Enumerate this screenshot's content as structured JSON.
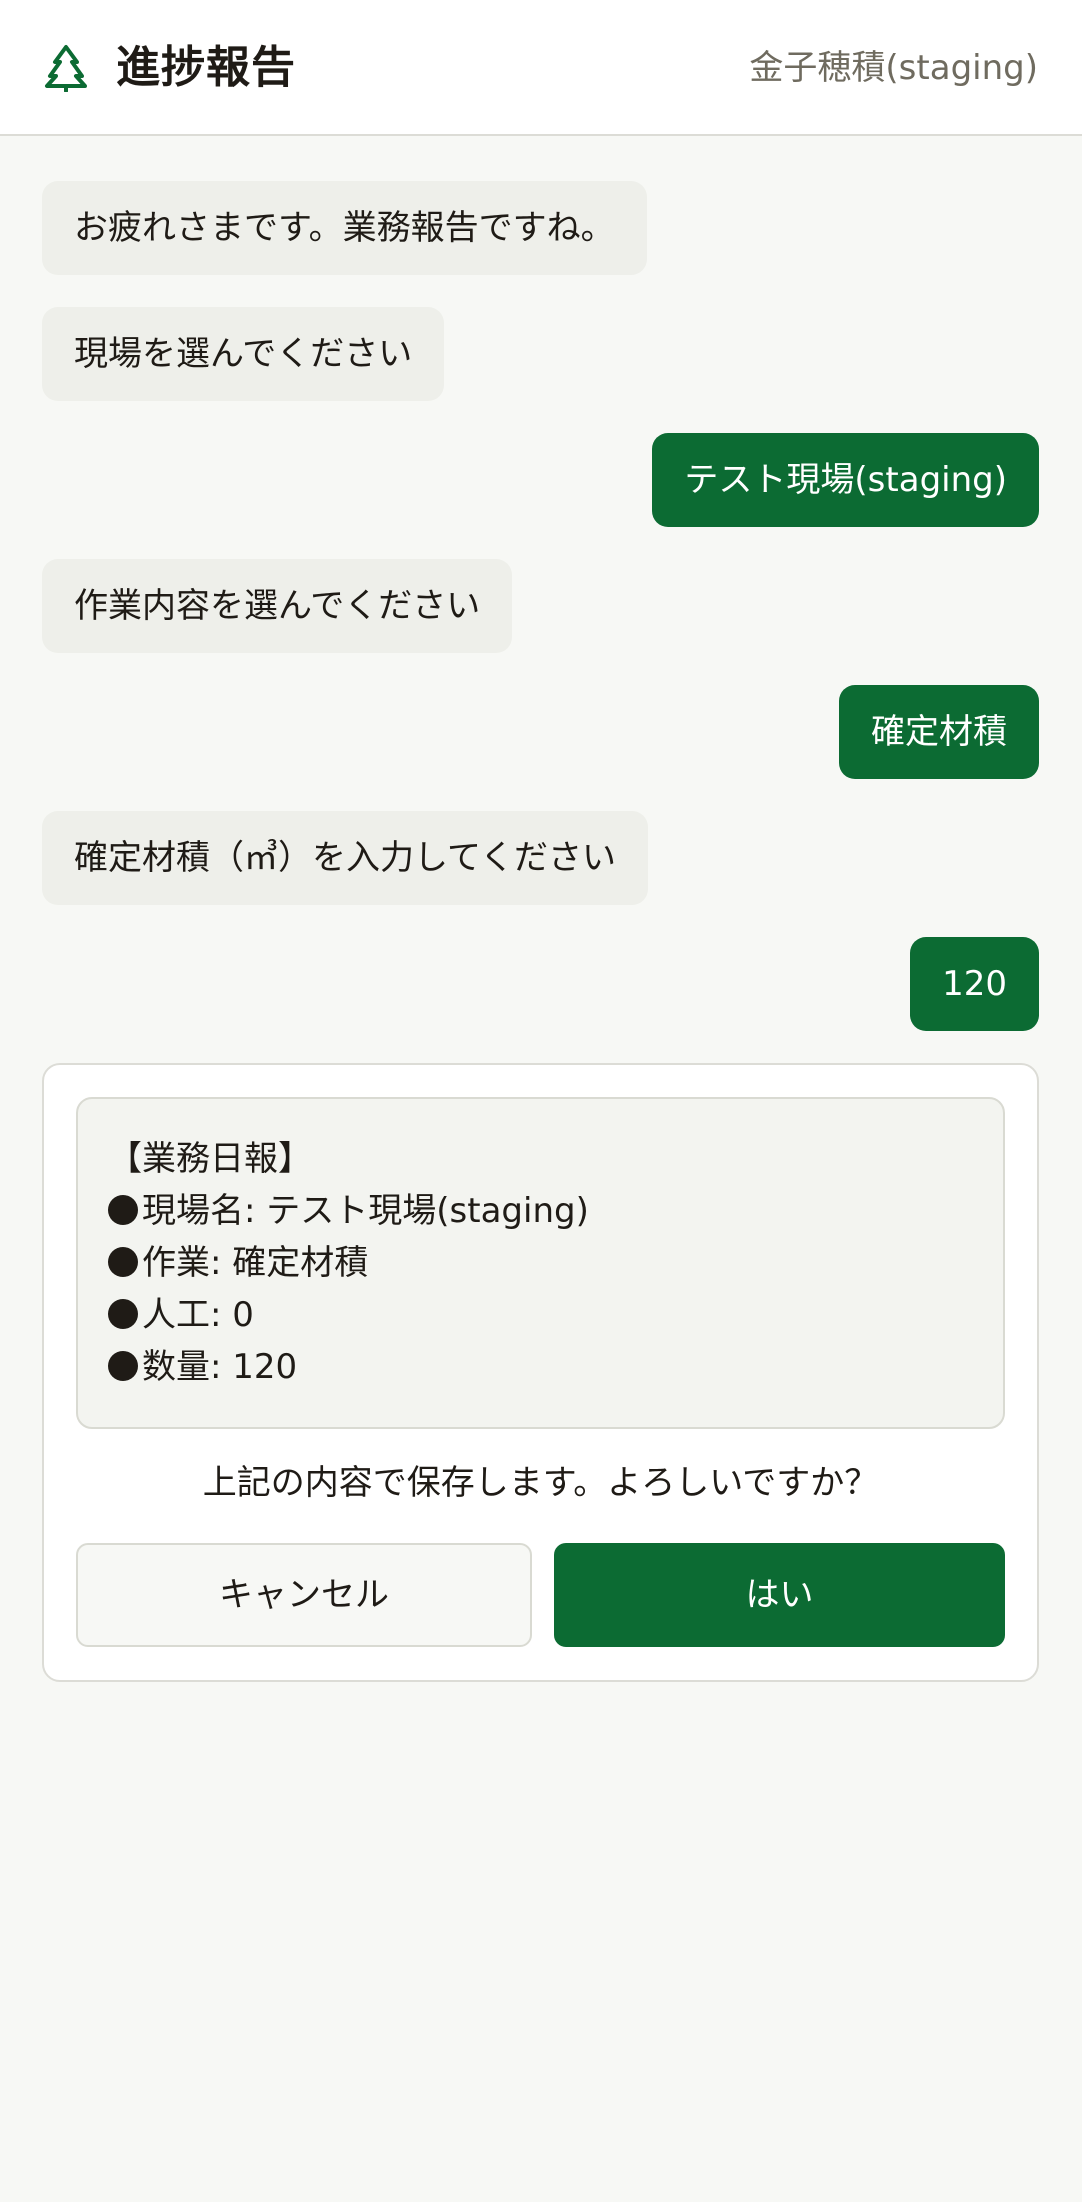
{
  "header": {
    "title": "進捗報告",
    "logo_icon": "tree-icon",
    "user_name": "金子穂積(staging)"
  },
  "colors": {
    "brand_green": "#0c6b33",
    "bot_bubble": "#eeefea",
    "background": "#f7f8f5"
  },
  "chat": {
    "messages": [
      {
        "role": "bot",
        "text": "お疲れさまです。業務報告ですね。"
      },
      {
        "role": "bot",
        "text": "現場を選んでください"
      },
      {
        "role": "user",
        "text": "テスト現場(staging)"
      },
      {
        "role": "bot",
        "text": "作業内容を選んでください"
      },
      {
        "role": "user",
        "text": "確定材積"
      },
      {
        "role": "bot",
        "text": "確定材積（㎥）を入力してください"
      },
      {
        "role": "user",
        "text": "120"
      }
    ]
  },
  "confirm": {
    "summary": {
      "heading": "【業務日報】",
      "lines": [
        {
          "label": "現場名",
          "value": "テスト現場(staging)"
        },
        {
          "label": "作業",
          "value": "確定材積"
        },
        {
          "label": "人工",
          "value": "0"
        },
        {
          "label": "数量",
          "value": "120"
        }
      ]
    },
    "question": "上記の内容で保存します。よろしいですか？",
    "cancel_label": "キャンセル",
    "yes_label": "はい"
  }
}
